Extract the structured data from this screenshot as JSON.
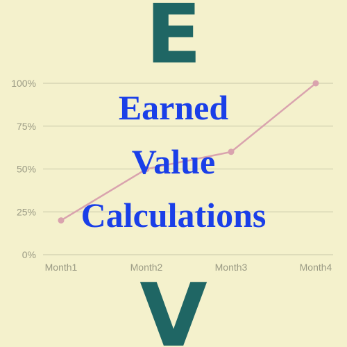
{
  "banner": {
    "top_letter": "E",
    "bottom_letter": "V",
    "title_lines": [
      "Earned",
      "Value",
      "Calculations"
    ]
  },
  "colors": {
    "background": "#f4f1cc",
    "letters": "#1f6664",
    "title": "#1a3fe8",
    "line": "#d9a3ae",
    "grid": "#c8c8a8",
    "ticks": "#9a9a84"
  },
  "chart_data": {
    "type": "line",
    "categories": [
      "Month1",
      "Month2",
      "Month3",
      "Month4"
    ],
    "series": [
      {
        "values": [
          20,
          50,
          60,
          100
        ]
      }
    ],
    "y_ticks": [
      "0%",
      "25%",
      "50%",
      "75%",
      "100%"
    ],
    "ylim": [
      0,
      100
    ],
    "grid": true,
    "legend": "none",
    "title": "",
    "xlabel": "",
    "ylabel": ""
  }
}
